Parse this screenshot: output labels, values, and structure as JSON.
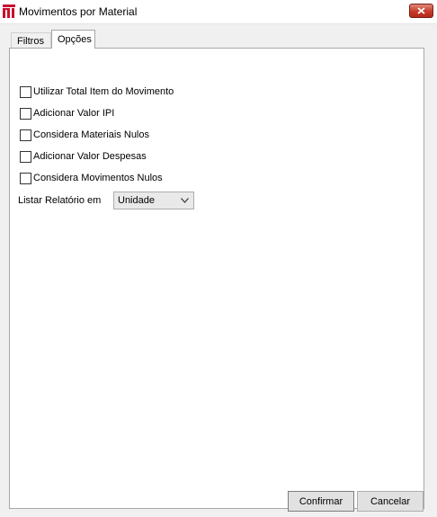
{
  "window": {
    "title": "Movimentos por Material",
    "icon": "app-logo-icon",
    "close_icon": "close-icon",
    "close_color": "#c63b2a"
  },
  "tabs": [
    {
      "label": "Filtros",
      "active": false
    },
    {
      "label": "Opções",
      "active": true
    }
  ],
  "options": {
    "checkboxes": [
      {
        "label": "Utilizar Total Item do Movimento",
        "checked": false
      },
      {
        "label": "Adicionar Valor IPI",
        "checked": false
      },
      {
        "label": "Considera Materiais Nulos",
        "checked": false
      },
      {
        "label": "Adicionar Valor Despesas",
        "checked": false
      },
      {
        "label": "Considera Movimentos Nulos",
        "checked": false
      }
    ],
    "listar": {
      "label": "Listar Relatório em",
      "selected": "Unidade"
    }
  },
  "buttons": {
    "confirm": "Confirmar",
    "cancel": "Cancelar"
  }
}
